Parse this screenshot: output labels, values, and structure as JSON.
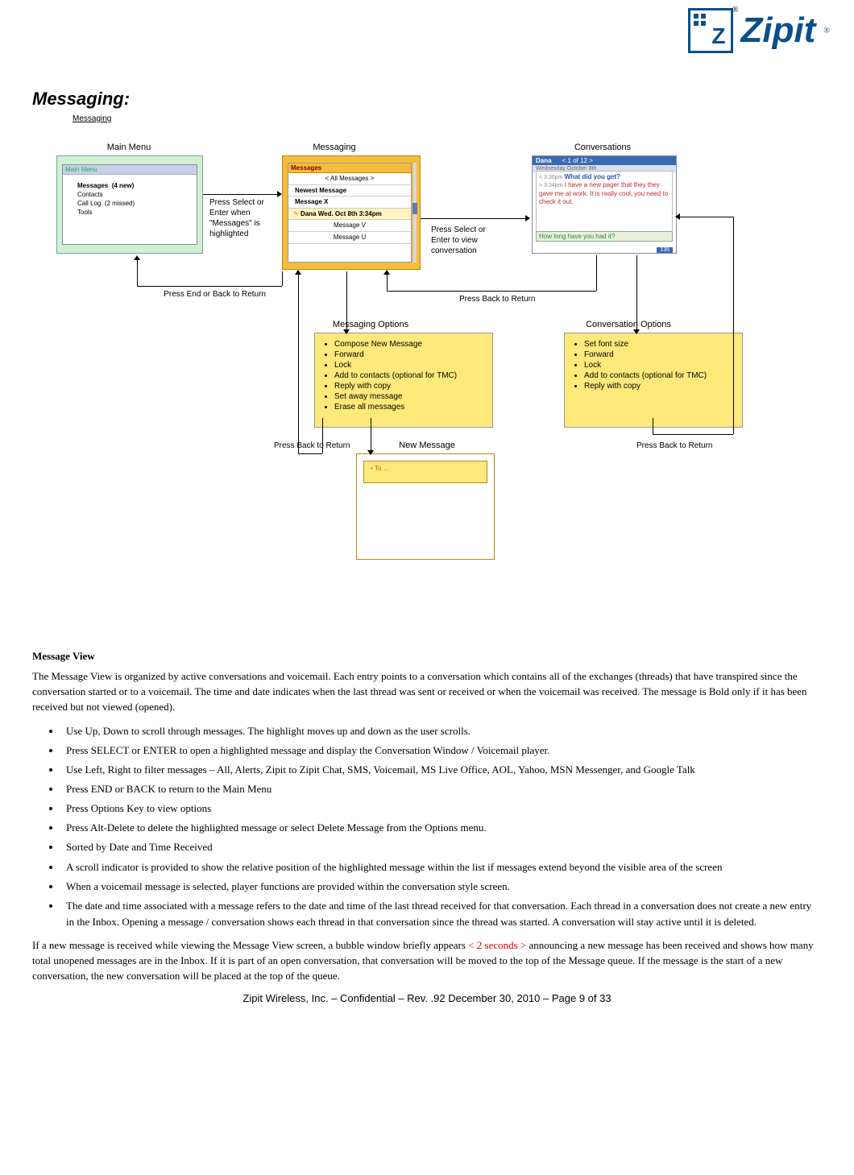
{
  "logo": {
    "text": "Zipit"
  },
  "section_title": "Messaging:",
  "section_sub": "Messaging",
  "diagram": {
    "main_menu": {
      "title": "Main Menu",
      "header": "Main Menu",
      "items": [
        {
          "label": "Messages",
          "note": "(4 new)",
          "bold": true
        },
        {
          "label": "Contacts",
          "note": ""
        },
        {
          "label": "Call Log",
          "note": "(2 missed)"
        },
        {
          "label": "Tools",
          "note": ""
        }
      ]
    },
    "messaging": {
      "title": "Messaging",
      "header": "Messages",
      "filter": "< All Messages >",
      "rows": [
        {
          "text": "Newest Message",
          "bold": true
        },
        {
          "text": "Message X",
          "bold": true
        },
        {
          "text": "Dana    Wed. Oct 8th  3:34pm",
          "sel": true
        },
        {
          "text": "Message V"
        },
        {
          "text": "Message U"
        }
      ]
    },
    "conversations": {
      "title": "Conversations",
      "name": "Dana",
      "counter": "<  1 of 12  >",
      "date": "Wednesday October 8th",
      "line1_time": "< 3:30pm",
      "line1_text": "What did you get?",
      "line2_time": "> 3:34pm",
      "line2_text": "I have a new pager that they they gave me at work.  It is really cool, you need to check it out.",
      "input": "How long have you had it?",
      "foot": "135"
    },
    "messaging_options": {
      "title": "Messaging Options",
      "items": [
        "Compose New Message",
        "Forward",
        "Lock",
        "Add to contacts (optional for TMC)",
        "Reply with copy",
        "Set away message",
        "Erase all messages"
      ]
    },
    "conversation_options": {
      "title": "Conversation Options",
      "items": [
        "Set font size",
        "Forward",
        "Lock",
        "Add to contacts (optional for TMC)",
        "Reply with copy"
      ]
    },
    "new_message": {
      "title": "New Message",
      "to": "To …"
    },
    "hints": {
      "h1": "Press Select or Enter when \"Messages\" is highlighted",
      "h2": "Press Select or Enter to view conversation",
      "h3": "Press End or Back to Return",
      "h4": "Press Back to Return",
      "h5": "Press Back to Return",
      "h6": "Press Back to Return"
    }
  },
  "doc": {
    "h2": "Message View",
    "p1": "The Message View is organized by active conversations and voicemail.  Each entry points to a conversation which contains all of the exchanges (threads) that have transpired since the conversation started or to a voicemail.  The time and date indicates when the last thread was sent or received or when the voicemail was received.  The message is Bold only if it has been received but not viewed (opened).",
    "bullets": [
      "Use Up, Down to scroll through messages.  The highlight moves up and down as the user scrolls.",
      "Press SELECT or ENTER to open a highlighted message and display the Conversation Window /  Voicemail player.",
      "Use Left, Right to filter messages – All, Alerts, Zipit to Zipit Chat, SMS,  Voicemail, MS Live Office, AOL, Yahoo, MSN Messenger, and Google Talk",
      "Press END or BACK to return to the Main Menu",
      "Press Options Key to view options",
      "Press Alt-Delete to delete the highlighted message or select Delete Message from the Options menu.",
      "Sorted by Date and Time Received",
      "A scroll indicator is provided to show the relative position of the highlighted message within the list if messages extend beyond the visible area of the screen",
      " When a voicemail message is selected, player functions are provided within the conversation style screen.",
      "The date and time associated with a message refers to the date and time of the last thread received for that conversation.  Each thread in a conversation does not create a new entry in the Inbox.  Opening a message / conversation shows each thread in that conversation since the thread was started.  A conversation will stay active until it is deleted."
    ],
    "p2a": "If a new message is received while viewing the Message View screen, a bubble window briefly appears ",
    "p2red": "< 2 seconds >",
    "p2b": " announcing a new message has been received and shows how many total unopened messages are in the Inbox.  If it is part of an open conversation, that conversation will be moved to the top of the Message queue.  If the message is the start of a new conversation, the new conversation will be placed at the top of the queue."
  },
  "footer": "Zipit Wireless, Inc. – Confidential – Rev. .92 December 30, 2010 – Page 9 of 33"
}
